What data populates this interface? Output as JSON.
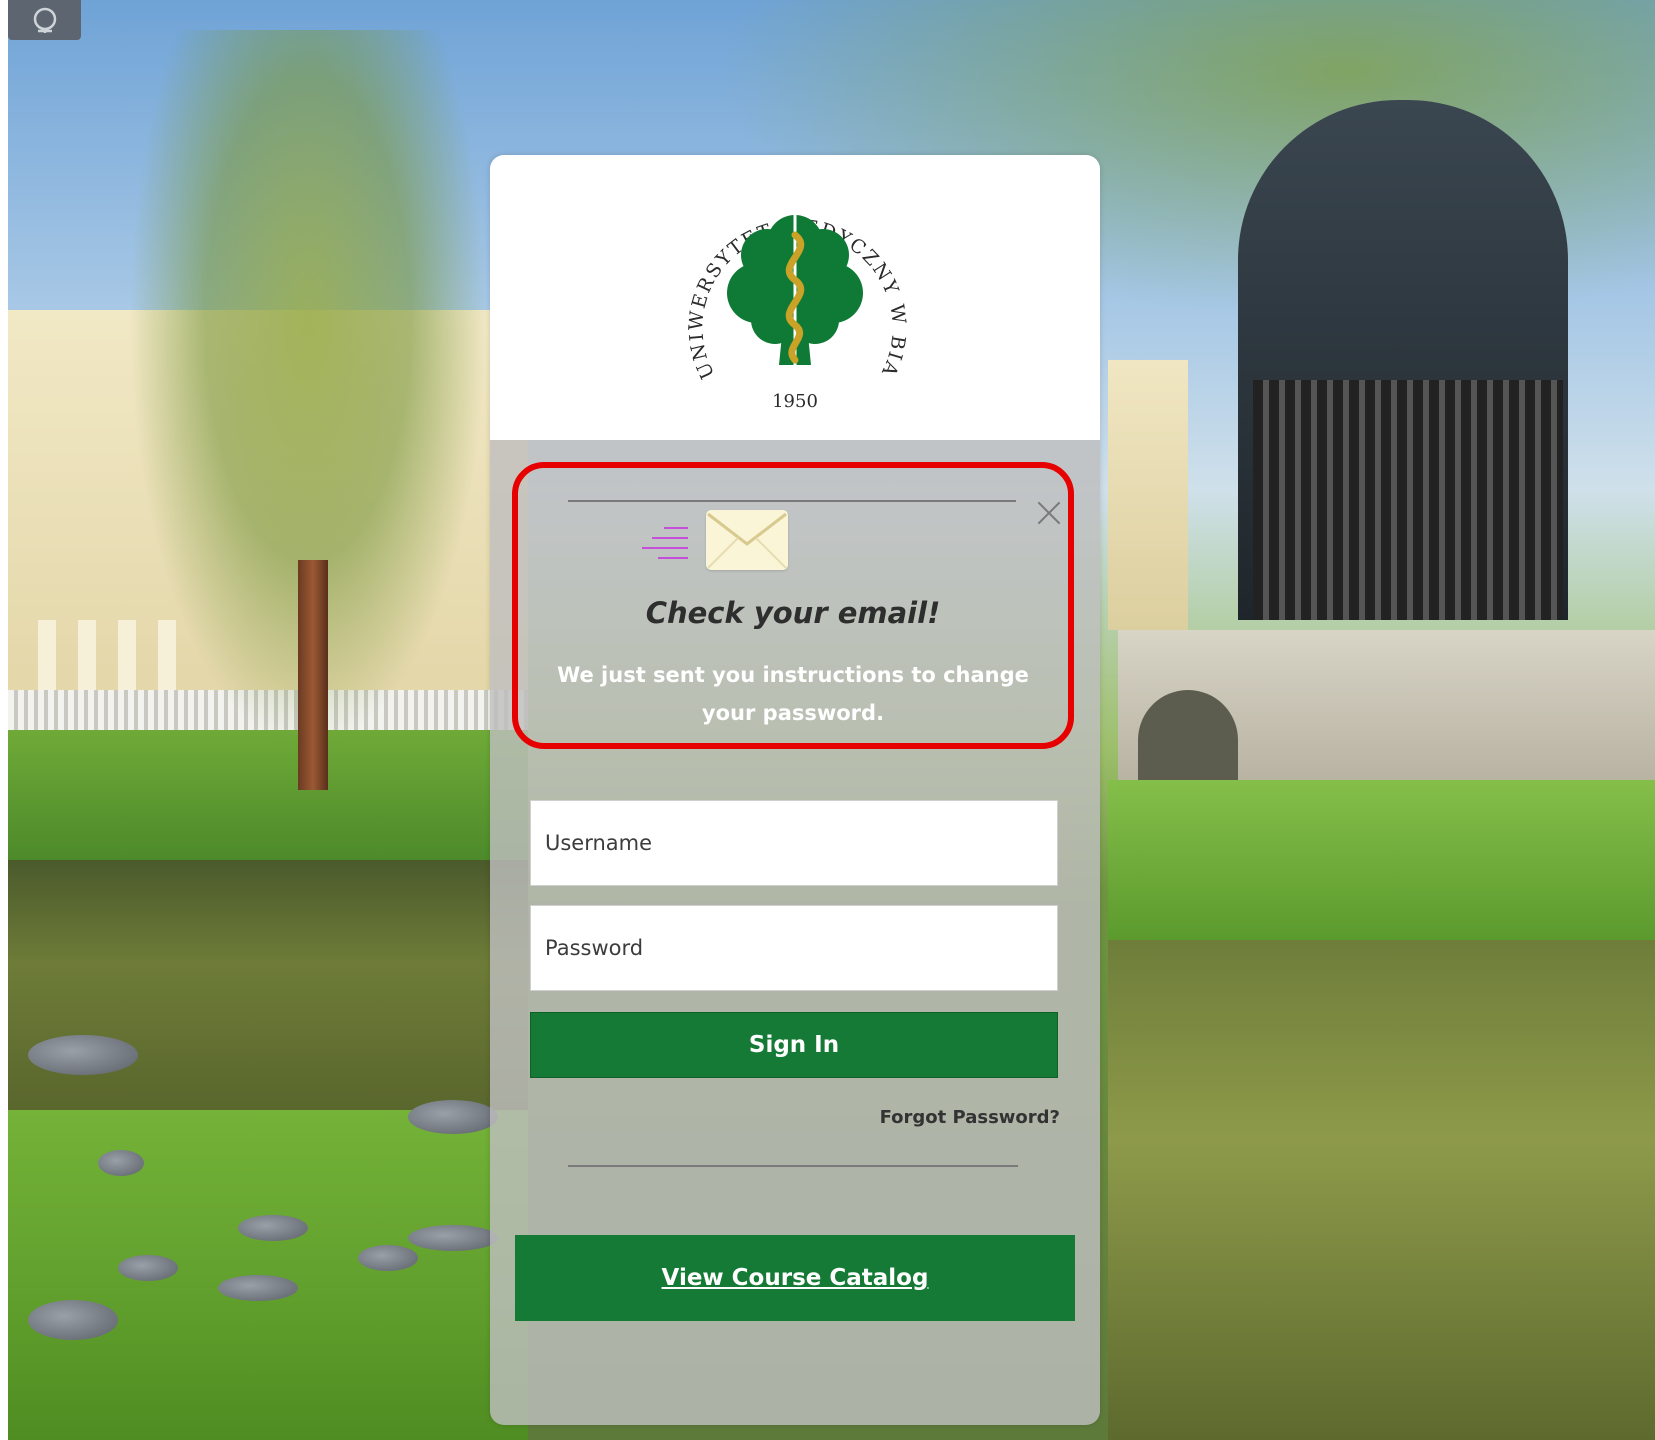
{
  "logo": {
    "arc_text": "UNIWERSYTET MEDYCZNY W BIAŁYMSTOKU",
    "year": "1950"
  },
  "alert": {
    "title": "Check your email!",
    "message": "We just sent you instructions to change your password.",
    "close_icon": "close-icon",
    "envelope_icon": "envelope-icon"
  },
  "login": {
    "username_placeholder": "Username",
    "password_placeholder": "Password",
    "signin_label": "Sign In",
    "forgot_label": "Forgot Password?",
    "catalog_label": "View Course Catalog"
  },
  "colors": {
    "brand_green": "#157a35",
    "highlight_red": "#e60000",
    "logo_green": "#0e7a35",
    "logo_gold": "#c9a227"
  }
}
